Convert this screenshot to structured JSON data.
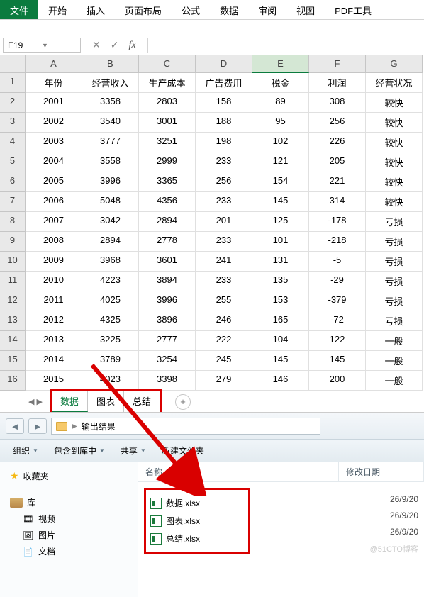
{
  "ribbon": {
    "tabs": [
      "文件",
      "开始",
      "插入",
      "页面布局",
      "公式",
      "数据",
      "审阅",
      "视图",
      "PDF工具"
    ],
    "active": 0
  },
  "formula_bar": {
    "name_box": "E19",
    "formula": ""
  },
  "grid": {
    "col_headers": [
      "A",
      "B",
      "C",
      "D",
      "E",
      "F",
      "G"
    ],
    "selected_col": "E",
    "row_headers": [
      1,
      2,
      3,
      4,
      5,
      6,
      7,
      8,
      9,
      10,
      11,
      12,
      13,
      14,
      15,
      16
    ],
    "rows": [
      [
        "年份",
        "经营收入",
        "生产成本",
        "广告费用",
        "税金",
        "利润",
        "经营状况"
      ],
      [
        "2001",
        "3358",
        "2803",
        "158",
        "89",
        "308",
        "较快"
      ],
      [
        "2002",
        "3540",
        "3001",
        "188",
        "95",
        "256",
        "较快"
      ],
      [
        "2003",
        "3777",
        "3251",
        "198",
        "102",
        "226",
        "较快"
      ],
      [
        "2004",
        "3558",
        "2999",
        "233",
        "121",
        "205",
        "较快"
      ],
      [
        "2005",
        "3996",
        "3365",
        "256",
        "154",
        "221",
        "较快"
      ],
      [
        "2006",
        "5048",
        "4356",
        "233",
        "145",
        "314",
        "较快"
      ],
      [
        "2007",
        "3042",
        "2894",
        "201",
        "125",
        "-178",
        "亏损"
      ],
      [
        "2008",
        "2894",
        "2778",
        "233",
        "101",
        "-218",
        "亏损"
      ],
      [
        "2009",
        "3968",
        "3601",
        "241",
        "131",
        "-5",
        "亏损"
      ],
      [
        "2010",
        "4223",
        "3894",
        "233",
        "135",
        "-29",
        "亏损"
      ],
      [
        "2011",
        "4025",
        "3996",
        "255",
        "153",
        "-379",
        "亏损"
      ],
      [
        "2012",
        "4325",
        "3896",
        "246",
        "165",
        "-72",
        "亏损"
      ],
      [
        "2013",
        "3225",
        "2777",
        "222",
        "104",
        "122",
        "一般"
      ],
      [
        "2014",
        "3789",
        "3254",
        "245",
        "145",
        "145",
        "一般"
      ],
      [
        "2015",
        "4023",
        "3398",
        "279",
        "146",
        "200",
        "一般"
      ]
    ]
  },
  "sheet_tabs": {
    "tabs": [
      "数据",
      "图表",
      "总结"
    ],
    "active": 0
  },
  "explorer": {
    "breadcrumb": "输出结果",
    "toolbar": {
      "organize": "组织",
      "include": "包含到库中",
      "share": "共享",
      "newfolder": "新建文件夹"
    },
    "nav": {
      "favorites": "收藏夹",
      "library": "库",
      "items": [
        "视频",
        "图片",
        "文档"
      ]
    },
    "columns": {
      "name": "名称",
      "date": "修改日期"
    },
    "files": [
      {
        "name": "数据.xlsx",
        "date": "26/9/20"
      },
      {
        "name": "图表.xlsx",
        "date": "26/9/20"
      },
      {
        "name": "总结.xlsx",
        "date": "26/9/20"
      }
    ]
  },
  "watermark": "@51CTO博客"
}
